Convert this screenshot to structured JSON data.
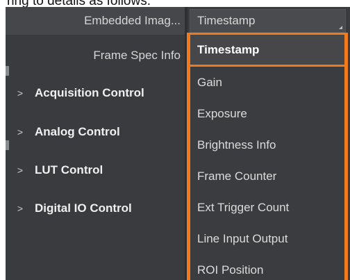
{
  "top_caption": "ring to details as follows.",
  "tree": {
    "sub_items": [
      {
        "label": "Embedded Imag..."
      },
      {
        "label": "Frame Spec Info"
      }
    ],
    "groups": [
      {
        "label": "Acquisition Control",
        "chevron": ">"
      },
      {
        "label": "Analog Control",
        "chevron": ">"
      },
      {
        "label": "LUT Control",
        "chevron": ">"
      },
      {
        "label": "Digital IO Control",
        "chevron": ">"
      }
    ]
  },
  "combo": {
    "value": "Timestamp"
  },
  "dropdown": {
    "options": [
      {
        "label": "Timestamp",
        "selected": true
      },
      {
        "label": "Gain"
      },
      {
        "label": "Exposure"
      },
      {
        "label": "Brightness Info"
      },
      {
        "label": "Frame Counter"
      },
      {
        "label": "Ext Trigger Count"
      },
      {
        "label": "Line Input Output"
      },
      {
        "label": "ROI Position"
      }
    ]
  },
  "colors": {
    "panel_bg": "#3a3b3e",
    "accent_orange": "#f07a1c",
    "text": "#e8e8e8"
  }
}
